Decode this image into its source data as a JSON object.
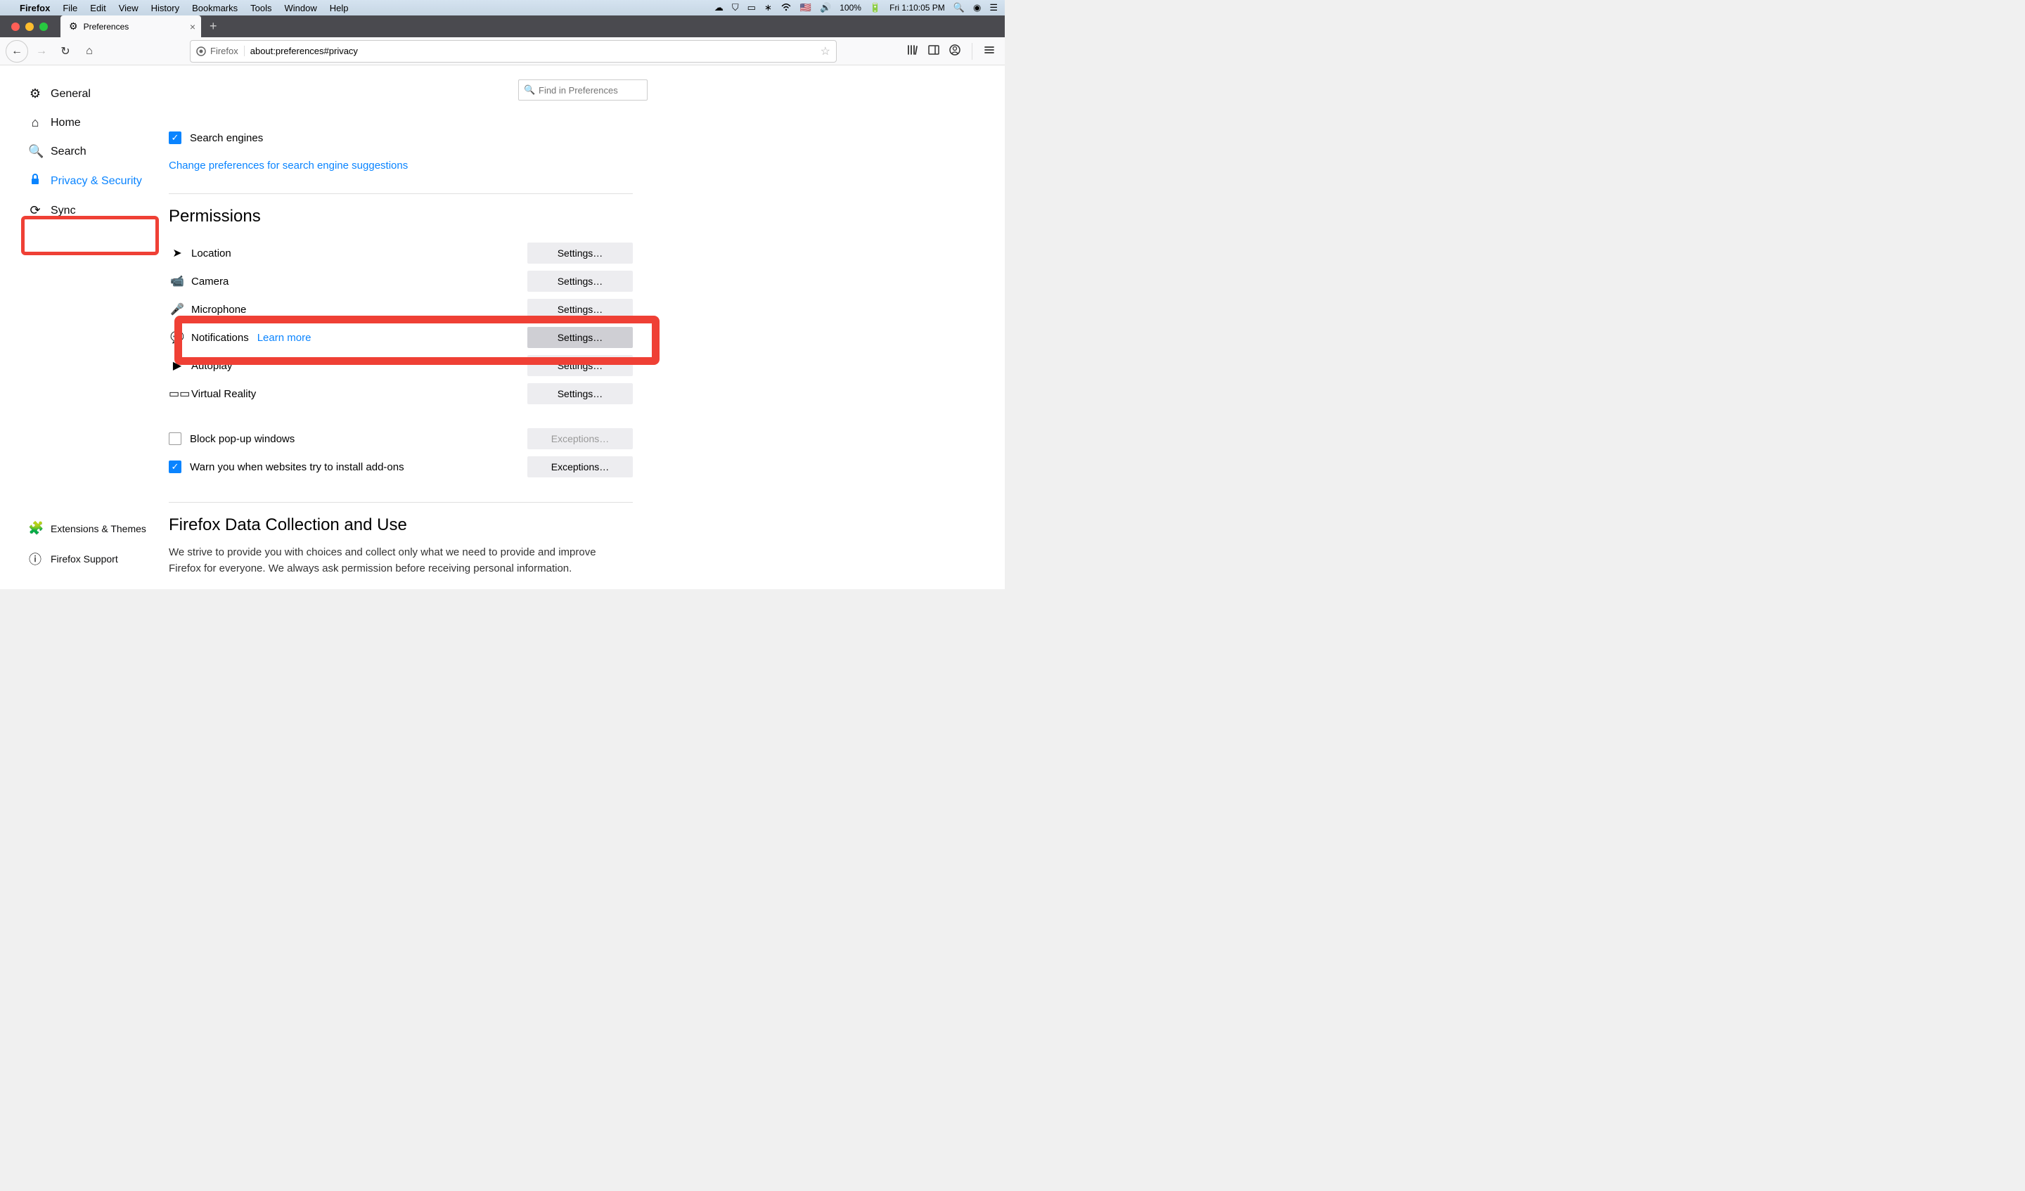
{
  "menubar": {
    "app": "Firefox",
    "items": [
      "File",
      "Edit",
      "View",
      "History",
      "Bookmarks",
      "Tools",
      "Window",
      "Help"
    ],
    "battery": "100%",
    "time": "Fri 1:10:05 PM"
  },
  "tab": {
    "title": "Preferences"
  },
  "urlbar": {
    "identity": "Firefox",
    "url": "about:preferences#privacy"
  },
  "search": {
    "placeholder": "Find in Preferences"
  },
  "sidebar": {
    "general": "General",
    "home": "Home",
    "search": "Search",
    "privacy": "Privacy & Security",
    "sync": "Sync",
    "extensions": "Extensions & Themes",
    "support": "Firefox Support"
  },
  "addressbar_section": {
    "search_engines": "Search engines",
    "change_link": "Change preferences for search engine suggestions"
  },
  "permissions": {
    "title": "Permissions",
    "location": "Location",
    "camera": "Camera",
    "microphone": "Microphone",
    "notifications": "Notifications",
    "learn_more": "Learn more",
    "autoplay": "Autoplay",
    "vr": "Virtual Reality",
    "settings_btn": "Settings…",
    "block_popups": "Block pop-up windows",
    "warn_addons": "Warn you when websites try to install add-ons",
    "exceptions_btn": "Exceptions…"
  },
  "data_collection": {
    "title": "Firefox Data Collection and Use",
    "text": "We strive to provide you with choices and collect only what we need to provide and improve Firefox for everyone. We always ask permission before receiving personal information."
  }
}
